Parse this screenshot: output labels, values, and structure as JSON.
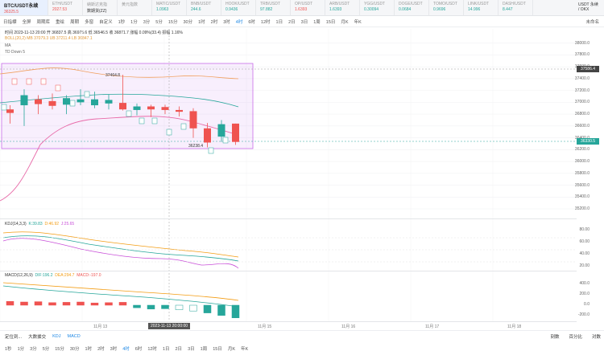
{
  "ticker_bar": {
    "items": [
      {
        "symbol": "BTC/USDT永续",
        "price": "36325.5",
        "dir": "down",
        "active": true
      },
      {
        "symbol": "ETH/USDT",
        "price": "2027.53",
        "dir": "down"
      },
      {
        "symbol": "納斯达克指",
        "price": "数期货(ZZ)",
        "dir": "none"
      },
      {
        "symbol": "黄元指数",
        "price": "",
        "dir": "none"
      },
      {
        "symbol": "MATIC/USDT",
        "price": "1.0963",
        "dir": "up"
      },
      {
        "symbol": "BNB/USDT",
        "price": "244.6",
        "dir": "up"
      },
      {
        "symbol": "HOOK/USDT",
        "price": "0.9436",
        "dir": "up"
      },
      {
        "symbol": "TRB/USDT",
        "price": "97.882",
        "dir": "up"
      },
      {
        "symbol": "OP/USDT",
        "price": "1.6393",
        "dir": "down"
      },
      {
        "symbol": "ARB/USDT",
        "price": "1.6393",
        "dir": "up"
      },
      {
        "symbol": "YGG/USDT",
        "price": "0.30094",
        "dir": "up"
      },
      {
        "symbol": "DOGE/USDT",
        "price": "0.0684",
        "dir": "up"
      },
      {
        "symbol": "TOMO/USDT",
        "price": "0.9696",
        "dir": "up"
      },
      {
        "symbol": "LINK/USDT",
        "price": "14.996",
        "dir": "up"
      },
      {
        "symbol": "DASH/USDT",
        "price": "8.447",
        "dir": "up"
      }
    ],
    "right_label": "USDT 永续 / OKX"
  },
  "toolbar": {
    "items": [
      "日指標",
      "全屏",
      "周期库",
      "重绘",
      "周期",
      "多窗",
      "自定义",
      "1秒",
      "1分",
      "3分",
      "5分",
      "15分",
      "30分",
      "1时",
      "2时",
      "3时",
      "4时",
      "6时",
      "12时",
      "1日",
      "2日",
      "3日",
      "1周",
      "15日",
      "月K",
      "年K"
    ],
    "selected": "4时",
    "right_label": "未命名"
  },
  "price_info": {
    "line1": "时间 2023-11-13 20:00 开 36837.5 高 36975.6 低 36546.5 收 36871.7 涨幅 0.09%(33.4) 振幅 1.16%",
    "boll": "BOLL(20,2)  MB 37079.3  UB 37211.4  LB 36847.1",
    "ma": "MA",
    "td": "TD  Down 5"
  },
  "price_axis": {
    "labels": [
      "38000.0",
      "37800.0",
      "37600.0",
      "37400.0",
      "37200.0",
      "37000.0",
      "36800.0",
      "36600.0",
      "36400.0",
      "36200.0",
      "36000.0",
      "35800.0",
      "35600.0",
      "35400.0",
      "35200.0"
    ],
    "tag_upper": "37586.4",
    "tag_current": "36330.5"
  },
  "annotations": {
    "high": "37464.8",
    "low": "36238.4"
  },
  "kdj": {
    "title": "KDJ(14,3,3)",
    "k": "K:39.83",
    "d": "D:46.92",
    "j": "J:25.65",
    "axis": [
      "80.00",
      "60.00",
      "40.00",
      "20.00"
    ]
  },
  "macd": {
    "title": "MACD(12,26,9)",
    "dif": "DIF:196.2",
    "dea": "DEA:294.7",
    "macd": "MACD:-197.0",
    "axis": [
      "400.0",
      "200.0",
      "0.0",
      "-200.0"
    ]
  },
  "time_axis": {
    "labels": [
      "11月 13",
      "11月 15",
      "11月 16",
      "11月 17",
      "11月 18"
    ],
    "cursor_label": "2023-11-13 20:00:00"
  },
  "bottom_bar1": {
    "items": [
      "定位到...",
      "大数據交",
      "KDJ",
      "MACD"
    ],
    "right": [
      "刻数",
      "百分比",
      "对数"
    ]
  },
  "bottom_bar2": {
    "items": [
      "1秒",
      "1分",
      "3分",
      "5分",
      "15分",
      "30分",
      "1时",
      "2时",
      "3时",
      "4时",
      "6时",
      "12时",
      "1日",
      "2日",
      "3日",
      "1周",
      "15日",
      "月K",
      "年K"
    ],
    "selected": "4时"
  },
  "chart_data": {
    "type": "candlestick",
    "candles": [
      {
        "o": 36880,
        "h": 36950,
        "l": 36640,
        "c": 36820
      },
      {
        "o": 36950,
        "h": 37220,
        "l": 36600,
        "c": 37120
      },
      {
        "o": 37050,
        "h": 37120,
        "l": 36800,
        "c": 36970
      },
      {
        "o": 37020,
        "h": 37150,
        "l": 36880,
        "c": 36940
      },
      {
        "o": 36960,
        "h": 37120,
        "l": 36800,
        "c": 37070
      },
      {
        "o": 37000,
        "h": 37220,
        "l": 36950,
        "c": 37050
      },
      {
        "o": 36950,
        "h": 37180,
        "l": 36900,
        "c": 37050
      },
      {
        "o": 36980,
        "h": 37130,
        "l": 36880,
        "c": 37040
      },
      {
        "o": 36990,
        "h": 37464.8,
        "l": 36860,
        "c": 36880
      },
      {
        "o": 36870,
        "h": 36980,
        "l": 36780,
        "c": 36930
      },
      {
        "o": 36930,
        "h": 36960,
        "l": 36750,
        "c": 36880
      },
      {
        "o": 36920,
        "h": 36960,
        "l": 36800,
        "c": 36870
      },
      {
        "o": 36870,
        "h": 36930,
        "l": 36760,
        "c": 36840
      },
      {
        "o": 36850,
        "h": 36900,
        "l": 36400,
        "c": 36560
      },
      {
        "o": 36560,
        "h": 36650,
        "l": 36238.4,
        "c": 36320
      },
      {
        "o": 36420,
        "h": 36700,
        "l": 36330,
        "c": 36630
      },
      {
        "o": 36640,
        "h": 36640,
        "l": 36280,
        "c": 36330.5
      }
    ],
    "macd_hist": [
      60,
      50,
      55,
      40,
      45,
      50,
      35,
      40,
      45,
      -40,
      -60,
      -55,
      -70,
      -90,
      -120,
      -160,
      -197
    ],
    "ylim": [
      35200,
      38050
    ]
  }
}
